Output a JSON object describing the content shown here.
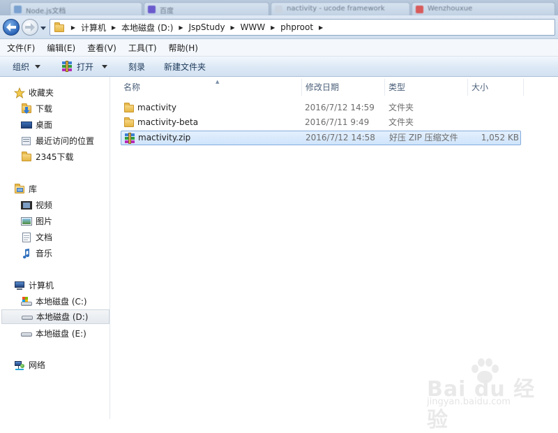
{
  "window": {
    "background_tabs": [
      "Node.js文档",
      "百度",
      "nactivity - ucode framework",
      "Wenzhouxue"
    ],
    "accent_color": "#2a64b7"
  },
  "address": {
    "breadcrumbs": [
      "计算机",
      "本地磁盘 (D:)",
      "JspStudy",
      "WWW",
      "phproot"
    ]
  },
  "menu": {
    "items": [
      "文件(F)",
      "编辑(E)",
      "查看(V)",
      "工具(T)",
      "帮助(H)"
    ]
  },
  "toolbar": {
    "organize_label": "组织",
    "open_label": "打开",
    "burn_label": "刻录",
    "new_folder_label": "新建文件夹"
  },
  "sidebar": {
    "favorites": {
      "label": "收藏夹",
      "items": [
        {
          "label": "下载",
          "icon": "downloads-folder-icon"
        },
        {
          "label": "桌面",
          "icon": "desktop-icon"
        },
        {
          "label": "最近访问的位置",
          "icon": "recent-places-icon"
        },
        {
          "label": "2345下载",
          "icon": "folder-icon"
        }
      ]
    },
    "libraries": {
      "label": "库",
      "items": [
        {
          "label": "视频",
          "icon": "video-icon"
        },
        {
          "label": "图片",
          "icon": "pictures-icon"
        },
        {
          "label": "文档",
          "icon": "documents-icon"
        },
        {
          "label": "音乐",
          "icon": "music-icon"
        }
      ]
    },
    "computer": {
      "label": "计算机",
      "items": [
        {
          "label": "本地磁盘 (C:)",
          "icon": "system-drive-icon"
        },
        {
          "label": "本地磁盘 (D:)",
          "icon": "drive-icon",
          "selected": true
        },
        {
          "label": "本地磁盘 (E:)",
          "icon": "drive-icon"
        }
      ]
    },
    "network": {
      "label": "网络"
    }
  },
  "file_list": {
    "columns": [
      "名称",
      "修改日期",
      "类型",
      "大小"
    ],
    "rows": [
      {
        "name": "mactivity",
        "date": "2016/7/12 14:59",
        "type": "文件夹",
        "size": "",
        "icon": "folder-icon"
      },
      {
        "name": "mactivity-beta",
        "date": "2016/7/11 9:49",
        "type": "文件夹",
        "size": "",
        "icon": "folder-icon"
      },
      {
        "name": "mactivity.zip",
        "date": "2016/7/12 14:58",
        "type": "好压 ZIP 压缩文件",
        "size": "1,052 KB",
        "icon": "zip-archive-icon",
        "selected": true
      }
    ]
  },
  "watermark": {
    "brand": "Bai du 经验",
    "url": "jingyan.baidu.com"
  }
}
